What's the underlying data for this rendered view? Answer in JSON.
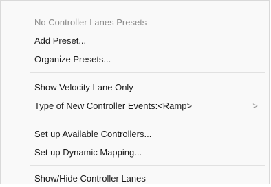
{
  "menu": {
    "items": [
      {
        "label": "No Controller Lanes Presets",
        "enabled": false,
        "submenu": false
      },
      {
        "label": "Add Preset...",
        "enabled": true,
        "submenu": false
      },
      {
        "label": "Organize Presets...",
        "enabled": true,
        "submenu": false
      },
      {
        "label": "Show Velocity Lane Only",
        "enabled": true,
        "submenu": false
      },
      {
        "label": "Type of New Controller Events:<Ramp>",
        "enabled": true,
        "submenu": true,
        "submenu_glyph": ">"
      },
      {
        "label": "Set up Available Controllers...",
        "enabled": true,
        "submenu": false
      },
      {
        "label": "Set up Dynamic Mapping...",
        "enabled": true,
        "submenu": false
      },
      {
        "label": "Show/Hide Controller Lanes",
        "enabled": true,
        "submenu": false
      }
    ]
  },
  "colors": {
    "menu_background": "#f9f9f9",
    "text": "#1a1a1a",
    "disabled_text": "#8a8a8a",
    "separator": "#e1e1e1"
  }
}
